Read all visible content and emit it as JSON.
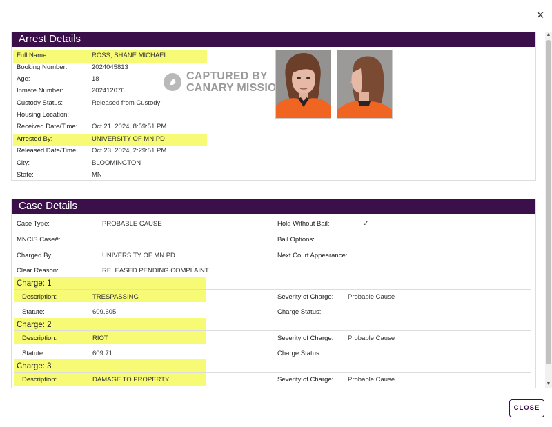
{
  "close_icon": "close-icon",
  "arrest": {
    "title": "Arrest Details",
    "fields": [
      {
        "label": "Full Name:",
        "value": "ROSS, SHANE MICHAEL",
        "highlight": true
      },
      {
        "label": "Booking Number:",
        "value": "2024045813"
      },
      {
        "label": "Age:",
        "value": "18"
      },
      {
        "label": "Inmate Number:",
        "value": "202412076"
      },
      {
        "label": "Custody Status:",
        "value": "Released from Custody"
      },
      {
        "label": "Housing Location:",
        "value": ""
      },
      {
        "label": "Received Date/Time:",
        "value": "Oct 21, 2024, 8:59:51 PM"
      },
      {
        "label": "Arrested By:",
        "value": "UNIVERSITY OF MN PD",
        "highlight": true
      },
      {
        "label": "Released Date/Time:",
        "value": "Oct 23, 2024, 2:29:51 PM"
      },
      {
        "label": "City:",
        "value": "BLOOMINGTON"
      },
      {
        "label": "State:",
        "value": "MN"
      }
    ],
    "watermark": {
      "line1": "CAPTURED BY",
      "line2": "CANARY MISSION"
    }
  },
  "case": {
    "title": "Case Details",
    "left": [
      {
        "label": "Case Type:",
        "value": "PROBABLE CAUSE"
      },
      {
        "label": "MNCIS Case#:",
        "value": ""
      },
      {
        "label": "Charged By:",
        "value": "UNIVERSITY OF MN PD"
      },
      {
        "label": "Clear Reason:",
        "value": "RELEASED PENDING COMPLAINT"
      }
    ],
    "right": [
      {
        "label": "Hold Without Bail:",
        "value": "✓"
      },
      {
        "label": "Bail Options:",
        "value": ""
      },
      {
        "label": "Next Court Appearance:",
        "value": ""
      }
    ],
    "charges": [
      {
        "title": "Charge: 1",
        "description_label": "Description:",
        "description": "TRESPASSING",
        "statute_label": "Statute:",
        "statute": "609.605",
        "severity_label": "Severity of Charge:",
        "severity": "Probable Cause",
        "status_label": "Charge Status:",
        "status": ""
      },
      {
        "title": "Charge: 2",
        "description_label": "Description:",
        "description": "RIOT",
        "statute_label": "Statute:",
        "statute": "609.71",
        "severity_label": "Severity of Charge:",
        "severity": "Probable Cause",
        "status_label": "Charge Status:",
        "status": ""
      },
      {
        "title": "Charge: 3",
        "description_label": "Description:",
        "description": "DAMAGE TO PROPERTY",
        "severity_label": "Severity of Charge:",
        "severity": "Probable Cause"
      }
    ]
  },
  "footer": {
    "close_label": "CLOSE"
  },
  "colors": {
    "header": "#3b0f4a",
    "highlight": "#f6fa74"
  }
}
